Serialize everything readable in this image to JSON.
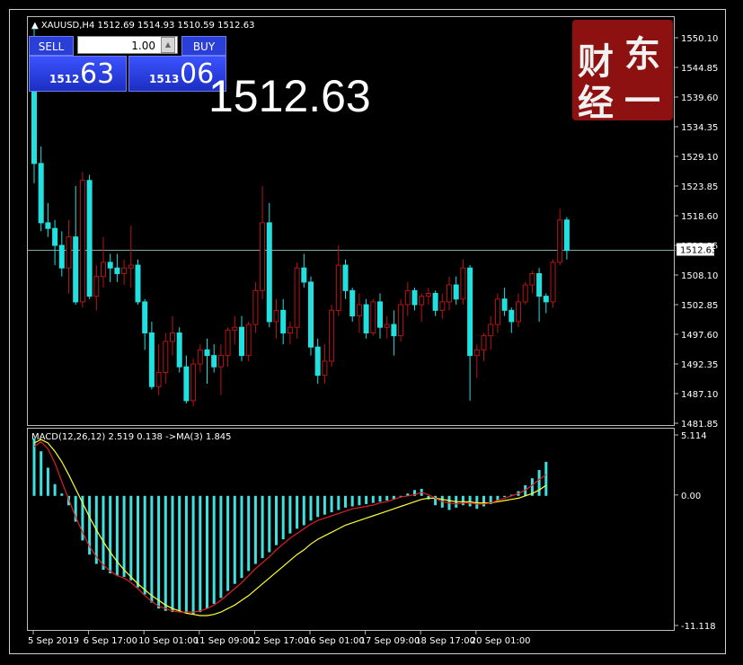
{
  "chart": {
    "symbol_header": "▲ XAUUSD,H4  1512.69 1514.93 1510.59 1512.63",
    "current_price": "1512.63",
    "big_price": "1512.63",
    "price_ticks": [
      "1550.10",
      "1544.85",
      "1539.60",
      "1534.35",
      "1529.10",
      "1523.85",
      "1518.60",
      "1513.35",
      "1508.10",
      "1502.85",
      "1497.60",
      "1492.35",
      "1487.10",
      "1481.85"
    ],
    "macd_header": "MACD(12,26,12) 2.519 0.138  ->MA(3) 1.845",
    "macd_ticks": [
      "5.114",
      "0.00",
      "-11.118"
    ],
    "time_labels": [
      "5 Sep 2019",
      "6 Sep 17:00",
      "10 Sep 01:00",
      "11 Sep 09:00",
      "12 Sep 17:00",
      "16 Sep 01:00",
      "17 Sep 09:00",
      "18 Sep 17:00",
      "20 Sep 01:00"
    ],
    "colors": {
      "bull": "#b81414",
      "bear": "#20e0e0",
      "macd_hist": "#3ee0e0",
      "signal": "#ffff33",
      "ma": "#e02020"
    }
  },
  "trade_panel": {
    "sell_label": "SELL",
    "buy_label": "BUY",
    "lot_value": "1.00",
    "sell_small": "1512",
    "sell_big": "63",
    "buy_small": "1513",
    "buy_big": "06"
  },
  "logo": {
    "chars": [
      "财",
      "东",
      "经",
      "一"
    ]
  },
  "chart_data": {
    "type": "candlestick",
    "candles": [
      [
        1548.0,
        1552.0,
        1524.5,
        1528.0
      ],
      [
        1528.0,
        1531.0,
        1516.0,
        1517.5
      ],
      [
        1517.5,
        1521.0,
        1515.0,
        1516.5
      ],
      [
        1516.5,
        1518.0,
        1510.0,
        1513.5
      ],
      [
        1513.5,
        1516.0,
        1508.0,
        1509.5
      ],
      [
        1509.5,
        1518.0,
        1505.0,
        1515.0
      ],
      [
        1515.0,
        1524.0,
        1503.0,
        1503.5
      ],
      [
        1503.5,
        1526.5,
        1502.5,
        1525.0
      ],
      [
        1525.0,
        1526.0,
        1504.0,
        1504.5
      ],
      [
        1504.5,
        1510.0,
        1502.0,
        1508.0
      ],
      [
        1508.0,
        1515.0,
        1506.0,
        1510.5
      ],
      [
        1510.5,
        1512.0,
        1507.0,
        1509.5
      ],
      [
        1509.5,
        1512.0,
        1507.0,
        1508.5
      ],
      [
        1508.5,
        1511.0,
        1506.5,
        1509.5
      ],
      [
        1509.5,
        1517.0,
        1506.0,
        1510.0
      ],
      [
        1510.0,
        1511.0,
        1503.0,
        1503.5
      ],
      [
        1503.5,
        1504.0,
        1495.0,
        1498.0
      ],
      [
        1498.0,
        1500.0,
        1488.0,
        1488.5
      ],
      [
        1488.5,
        1496.0,
        1487.0,
        1491.0
      ],
      [
        1491.0,
        1498.0,
        1489.0,
        1496.5
      ],
      [
        1496.5,
        1501.0,
        1494.0,
        1498.0
      ],
      [
        1498.0,
        1499.0,
        1491.0,
        1492.0
      ],
      [
        1492.0,
        1494.0,
        1485.5,
        1486.0
      ],
      [
        1486.0,
        1493.5,
        1485.0,
        1492.5
      ],
      [
        1492.5,
        1496.0,
        1491.0,
        1495.0
      ],
      [
        1495.0,
        1497.0,
        1489.0,
        1494.0
      ],
      [
        1494.0,
        1496.0,
        1491.0,
        1492.0
      ],
      [
        1492.0,
        1496.0,
        1487.0,
        1494.0
      ],
      [
        1494.0,
        1499.0,
        1492.0,
        1498.5
      ],
      [
        1498.5,
        1501.0,
        1496.0,
        1499.0
      ],
      [
        1499.0,
        1501.0,
        1493.0,
        1494.0
      ],
      [
        1494.0,
        1500.0,
        1493.0,
        1499.5
      ],
      [
        1499.5,
        1507.0,
        1498.0,
        1505.5
      ],
      [
        1505.5,
        1524.0,
        1504.0,
        1517.5
      ],
      [
        1517.5,
        1521.0,
        1499.0,
        1500.0
      ],
      [
        1500.0,
        1504.0,
        1497.0,
        1502.0
      ],
      [
        1502.0,
        1504.0,
        1496.0,
        1498.0
      ],
      [
        1498.0,
        1500.0,
        1496.0,
        1499.0
      ],
      [
        1499.0,
        1510.5,
        1497.0,
        1509.5
      ],
      [
        1509.5,
        1512.0,
        1506.0,
        1507.0
      ],
      [
        1507.0,
        1508.0,
        1494.0,
        1495.5
      ],
      [
        1495.5,
        1497.0,
        1489.0,
        1490.5
      ],
      [
        1490.5,
        1496.0,
        1489.0,
        1493.0
      ],
      [
        1493.0,
        1503.0,
        1492.0,
        1502.0
      ],
      [
        1502.0,
        1513.5,
        1501.0,
        1510.0
      ],
      [
        1510.0,
        1511.0,
        1504.0,
        1505.5
      ],
      [
        1505.5,
        1506.0,
        1500.0,
        1501.0
      ],
      [
        1501.0,
        1505.0,
        1498.0,
        1503.0
      ],
      [
        1503.0,
        1504.0,
        1497.0,
        1498.0
      ],
      [
        1498.0,
        1504.0,
        1497.5,
        1503.5
      ],
      [
        1503.5,
        1505.0,
        1497.0,
        1499.0
      ],
      [
        1499.0,
        1501.0,
        1497.0,
        1499.5
      ],
      [
        1499.5,
        1502.0,
        1494.0,
        1497.5
      ],
      [
        1497.5,
        1504.0,
        1496.5,
        1503.0
      ],
      [
        1503.0,
        1507.0,
        1501.0,
        1505.5
      ],
      [
        1505.5,
        1506.0,
        1502.0,
        1503.0
      ],
      [
        1503.0,
        1505.0,
        1500.0,
        1504.5
      ],
      [
        1504.5,
        1506.0,
        1503.0,
        1505.0
      ],
      [
        1505.0,
        1505.5,
        1501.0,
        1502.0
      ],
      [
        1502.0,
        1505.0,
        1500.5,
        1503.5
      ],
      [
        1503.5,
        1508.0,
        1502.0,
        1506.5
      ],
      [
        1506.5,
        1508.0,
        1503.0,
        1504.0
      ],
      [
        1504.0,
        1511.0,
        1503.0,
        1509.5
      ],
      [
        1509.5,
        1510.0,
        1486.0,
        1494.0
      ],
      [
        1494.0,
        1496.0,
        1490.0,
        1495.0
      ],
      [
        1495.0,
        1498.0,
        1493.0,
        1497.5
      ],
      [
        1497.5,
        1501.0,
        1495.0,
        1499.5
      ],
      [
        1499.5,
        1505.0,
        1498.0,
        1504.0
      ],
      [
        1504.0,
        1506.0,
        1501.0,
        1502.0
      ],
      [
        1502.0,
        1502.5,
        1498.0,
        1500.0
      ],
      [
        1500.0,
        1505.0,
        1499.0,
        1503.5
      ],
      [
        1503.5,
        1507.0,
        1503.0,
        1506.5
      ],
      [
        1506.5,
        1509.0,
        1505.0,
        1508.5
      ],
      [
        1508.5,
        1509.5,
        1500.0,
        1504.5
      ],
      [
        1504.5,
        1505.0,
        1501.5,
        1503.5
      ],
      [
        1503.5,
        1511.0,
        1502.5,
        1510.5
      ],
      [
        1510.5,
        1520.0,
        1510.0,
        1518.0
      ],
      [
        1518.0,
        1518.5,
        1511.0,
        1512.6
      ]
    ],
    "macd_hist": [
      4.9,
      3.8,
      2.4,
      1.0,
      0.2,
      -0.8,
      -2.2,
      -3.8,
      -5.0,
      -5.8,
      -6.3,
      -6.6,
      -6.8,
      -6.9,
      -7.2,
      -7.8,
      -8.4,
      -9.1,
      -9.6,
      -9.8,
      -9.9,
      -9.8,
      -10.0,
      -10.1,
      -9.9,
      -9.6,
      -9.2,
      -8.7,
      -8.1,
      -7.5,
      -7.0,
      -6.4,
      -5.8,
      -5.3,
      -4.8,
      -4.2,
      -3.7,
      -3.2,
      -2.8,
      -2.5,
      -2.1,
      -1.8,
      -1.6,
      -1.4,
      -1.2,
      -1.0,
      -0.9,
      -0.8,
      -0.7,
      -0.6,
      -0.5,
      -0.4,
      -0.3,
      0.0,
      0.2,
      0.5,
      0.6,
      -0.3,
      -0.8,
      -1.0,
      -1.2,
      -1.0,
      -0.8,
      -0.9,
      -1.1,
      -0.9,
      -0.7,
      -0.4,
      -0.1,
      0.1,
      0.4,
      0.9,
      1.5,
      2.2,
      2.9
    ],
    "macd_ma": [
      4.2,
      4.6,
      4.0,
      2.8,
      1.2,
      -0.3,
      -1.8,
      -3.1,
      -4.3,
      -5.2,
      -5.9,
      -6.4,
      -6.8,
      -7.0,
      -7.4,
      -7.9,
      -8.5,
      -9.0,
      -9.4,
      -9.6,
      -9.8,
      -9.9,
      -9.9,
      -9.9,
      -9.8,
      -9.6,
      -9.3,
      -8.9,
      -8.4,
      -7.9,
      -7.4,
      -6.8,
      -6.2,
      -5.7,
      -5.2,
      -4.6,
      -4.1,
      -3.6,
      -3.2,
      -2.8,
      -2.4,
      -2.1,
      -1.9,
      -1.7,
      -1.5,
      -1.3,
      -1.1,
      -1.0,
      -0.9,
      -0.8,
      -0.6,
      -0.5,
      -0.3,
      -0.1,
      0.0,
      0.1,
      0.3,
      0.1,
      -0.2,
      -0.5,
      -0.6,
      -0.7,
      -0.6,
      -0.6,
      -0.7,
      -0.7,
      -0.6,
      -0.4,
      -0.2,
      0.0,
      0.2,
      0.5,
      0.9,
      1.4,
      1.8
    ],
    "macd_signal": [
      4.5,
      4.8,
      4.5,
      3.8,
      2.9,
      1.8,
      0.6,
      -0.6,
      -1.8,
      -2.9,
      -3.9,
      -4.8,
      -5.6,
      -6.3,
      -6.9,
      -7.5,
      -8.0,
      -8.5,
      -8.9,
      -9.3,
      -9.6,
      -9.8,
      -10.0,
      -10.1,
      -10.2,
      -10.2,
      -10.1,
      -9.9,
      -9.6,
      -9.3,
      -8.9,
      -8.5,
      -8.0,
      -7.5,
      -7.0,
      -6.5,
      -6.0,
      -5.5,
      -5.0,
      -4.6,
      -4.1,
      -3.7,
      -3.4,
      -3.1,
      -2.8,
      -2.5,
      -2.3,
      -2.1,
      -1.9,
      -1.7,
      -1.5,
      -1.3,
      -1.1,
      -0.9,
      -0.7,
      -0.5,
      -0.3,
      -0.2,
      -0.2,
      -0.3,
      -0.4,
      -0.5,
      -0.5,
      -0.5,
      -0.6,
      -0.6,
      -0.6,
      -0.5,
      -0.4,
      -0.3,
      -0.2,
      0.0,
      0.2,
      0.5,
      0.9
    ],
    "ylim": [
      1481.85,
      1550.1
    ],
    "macd_ylim": [
      -11.118,
      5.114
    ]
  }
}
